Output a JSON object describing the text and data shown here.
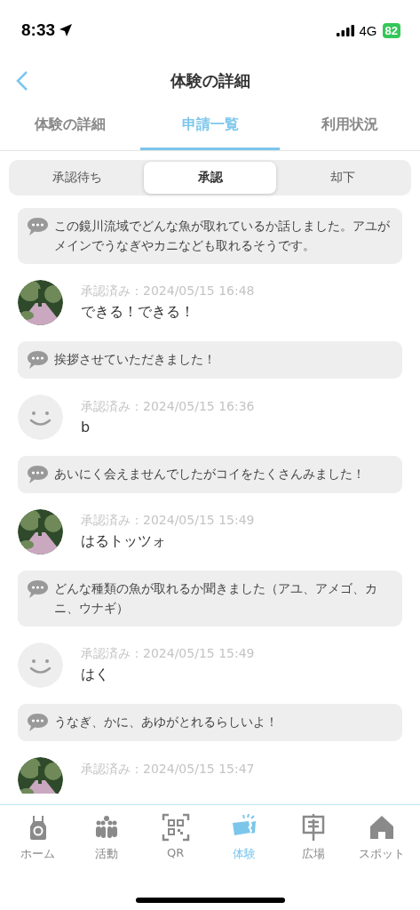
{
  "status_bar": {
    "time": "8:33",
    "network": "4G",
    "battery": "82"
  },
  "header": {
    "title": "体験の詳細"
  },
  "tabs": [
    {
      "label": "体験の詳細",
      "selected": false
    },
    {
      "label": "申請一覧",
      "selected": true
    },
    {
      "label": "利用状況",
      "selected": false
    }
  ],
  "filter": [
    {
      "label": "承認待ち",
      "selected": false
    },
    {
      "label": "承認",
      "selected": true
    },
    {
      "label": "却下",
      "selected": false
    }
  ],
  "entries": [
    {
      "kind": "comment",
      "text": "この鏡川流域でどんな魚が取れているか話しました。アユがメインでうなぎやカニなども取れるそうです。"
    },
    {
      "kind": "user",
      "photo": true,
      "date": "承認済み：2024/05/15 16:48",
      "name": "できる！できる！"
    },
    {
      "kind": "comment",
      "text": "挨拶させていただきました！"
    },
    {
      "kind": "user",
      "photo": false,
      "date": "承認済み：2024/05/15 16:36",
      "name": "b"
    },
    {
      "kind": "comment",
      "text": "あいにく会えませんでしたがコイをたくさんみました！"
    },
    {
      "kind": "user",
      "photo": true,
      "date": "承認済み：2024/05/15 15:49",
      "name": "はるトッツォ"
    },
    {
      "kind": "comment",
      "text": "どんな種類の魚が取れるか聞きました（アユ、アメゴ、カニ、ウナギ）"
    },
    {
      "kind": "user",
      "photo": false,
      "date": "承認済み：2024/05/15 15:49",
      "name": "はく"
    },
    {
      "kind": "comment",
      "text": "うなぎ、かに、あゆがとれるらしいよ！"
    },
    {
      "kind": "user",
      "photo": true,
      "date": "承認済み：2024/05/15 15:47"
    }
  ],
  "nav": [
    {
      "label": "ホーム",
      "selected": false
    },
    {
      "label": "活動",
      "selected": false
    },
    {
      "label": "QR",
      "selected": false
    },
    {
      "label": "体験",
      "selected": true
    },
    {
      "label": "広場",
      "selected": false
    },
    {
      "label": "スポット",
      "selected": false
    }
  ]
}
